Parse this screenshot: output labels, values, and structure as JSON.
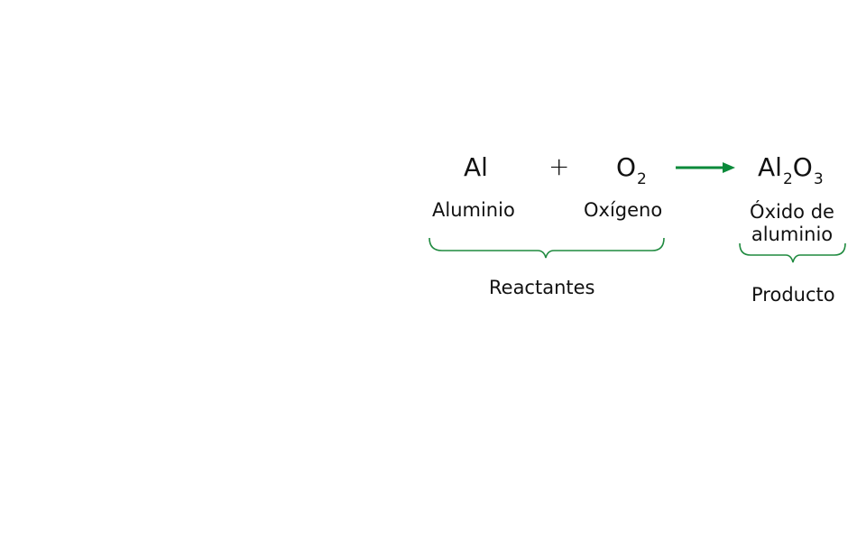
{
  "equation": {
    "reactant1": {
      "formula": "Al",
      "name": "Aluminio"
    },
    "operator": "+",
    "reactant2": {
      "symbol": "O",
      "subscript": "2",
      "name": "Oxígeno"
    },
    "product": {
      "symbol1": "Al",
      "subscript1": "2",
      "symbol2": "O",
      "subscript2": "3",
      "name_line1": "Óxido de",
      "name_line2": "aluminio"
    }
  },
  "groups": {
    "reactants_label": "Reactantes",
    "product_label": "Producto"
  },
  "colors": {
    "arrow": "#0a8a3a",
    "brace": "#1f8a3f",
    "text": "#111111"
  }
}
